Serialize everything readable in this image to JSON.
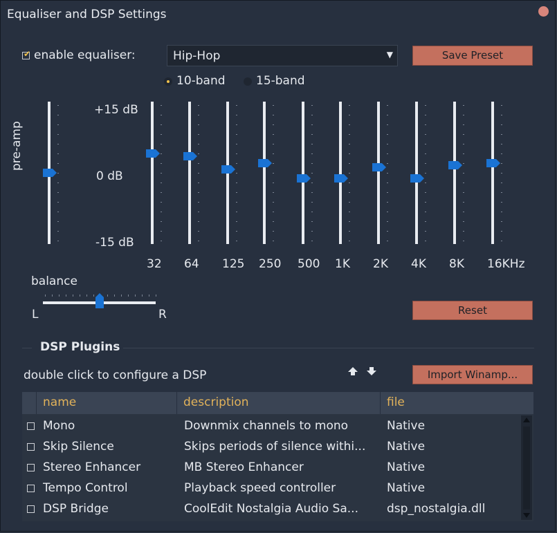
{
  "window": {
    "title": "Equaliser and DSP Settings"
  },
  "eq": {
    "enable_label": "enable equaliser:",
    "enabled": true,
    "preset_value": "Hip-Hop",
    "save_preset_label": "Save Preset",
    "band_modes": [
      "10-band",
      "15-band"
    ],
    "band_mode_selected": "10-band",
    "db_labels": {
      "top": "+15 dB",
      "mid": "0 dB",
      "bottom": "-15 dB"
    },
    "preamp_label": "pre-amp",
    "preamp_value_db": 0,
    "bands": [
      {
        "label": "32",
        "value_db": 4.5
      },
      {
        "label": "64",
        "value_db": 3.8
      },
      {
        "label": "125",
        "value_db": 0.8
      },
      {
        "label": "250",
        "value_db": 2.2
      },
      {
        "label": "500",
        "value_db": -1.2
      },
      {
        "label": "1K",
        "value_db": -1.2
      },
      {
        "label": "2K",
        "value_db": 1.2
      },
      {
        "label": "4K",
        "value_db": -1.2
      },
      {
        "label": "8K",
        "value_db": 1.8
      },
      {
        "label": "16KHz",
        "value_db": 2.2
      }
    ],
    "balance_label": "balance",
    "balance_left": "L",
    "balance_right": "R",
    "balance_value": 0.5,
    "reset_label": "Reset"
  },
  "dsp": {
    "section_title": "DSP Plugins",
    "hint": "double click to configure a DSP",
    "import_label": "Import Winamp...",
    "columns": [
      "name",
      "description",
      "file"
    ],
    "rows": [
      {
        "name": "Mono",
        "description": "Downmix channels to mono",
        "file": "Native",
        "checked": false
      },
      {
        "name": "Skip Silence",
        "description": "Skips periods of silence withi...",
        "file": "Native",
        "checked": false
      },
      {
        "name": "Stereo Enhancer",
        "description": "MB Stereo Enhancer",
        "file": "Native",
        "checked": false
      },
      {
        "name": "Tempo Control",
        "description": "Playback speed controller",
        "file": "Native",
        "checked": false
      },
      {
        "name": "DSP Bridge",
        "description": "CoolEdit Nostalgia Audio Sa...",
        "file": "dsp_nostalgia.dll",
        "checked": false
      }
    ]
  }
}
